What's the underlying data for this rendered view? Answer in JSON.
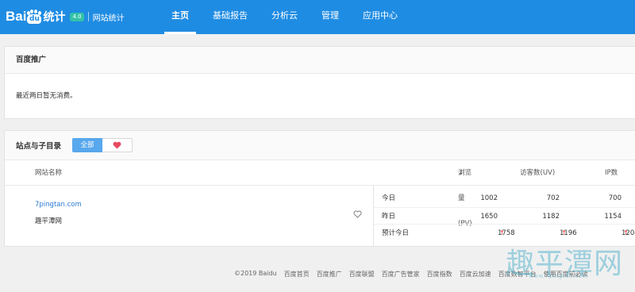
{
  "header": {
    "logo_text": "Bai",
    "logo_du": "du",
    "logo_product": "统计",
    "version": "4.0",
    "site_label": "网站统计",
    "nav": [
      {
        "label": "主页",
        "active": true
      },
      {
        "label": "基础报告",
        "active": false
      },
      {
        "label": "分析云",
        "active": false
      },
      {
        "label": "管理",
        "active": false
      },
      {
        "label": "应用中心",
        "active": false
      }
    ]
  },
  "promo": {
    "title": "百度推广",
    "message": "最近两日暂无消费。"
  },
  "sites": {
    "title": "站点与子目录",
    "filter_all": "全部",
    "filter_fav_icon": "heart-icon",
    "columns": {
      "name": "网站名称",
      "pv": "浏览量(PV)",
      "pv_sort": "↓",
      "uv": "访客数(UV)",
      "ip": "IP数"
    },
    "row": {
      "url": "7pingtan.com",
      "name": "趣平潭网",
      "stats": [
        {
          "label": "今日",
          "pv": "1002",
          "uv": "702",
          "ip": "700",
          "up": false
        },
        {
          "label": "昨日",
          "pv": "1650",
          "uv": "1182",
          "ip": "1154",
          "up": false
        },
        {
          "label": "预计今日",
          "pv": "1758",
          "uv": "1196",
          "ip": "1204",
          "up": true
        }
      ],
      "up_arrow": "↑"
    }
  },
  "footer": {
    "links": [
      "©2019 Baidu",
      "百度首页",
      "百度推广",
      "百度联盟",
      "百度广告管家",
      "百度指数",
      "百度云加速",
      "百度数智平台",
      "使用百度前必读"
    ]
  },
  "watermark": {
    "text": "趣平潭网",
    "url": "www.7pingtan.com"
  },
  "colors": {
    "topbar": "#1f8ce3",
    "accent_button": "#58a8ed",
    "link": "#2c7bd4",
    "up_arrow": "#e33333",
    "heart": "#e84a5f"
  }
}
